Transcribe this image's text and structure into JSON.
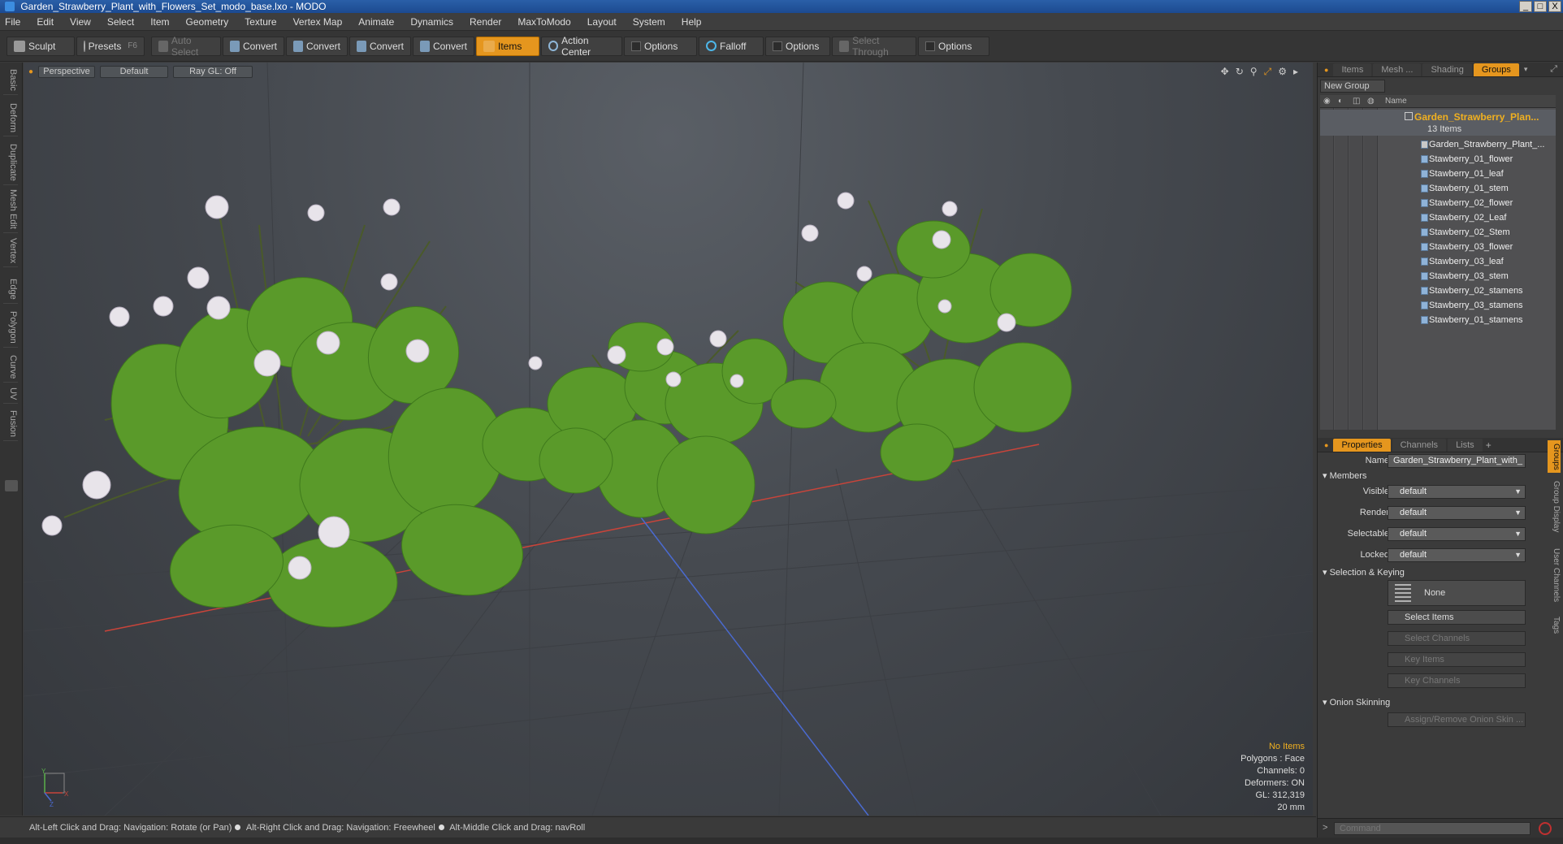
{
  "window": {
    "title": "Garden_Strawberry_Plant_with_Flowers_Set_modo_base.lxo - MODO",
    "buttons": [
      "_",
      "□",
      "X"
    ]
  },
  "menu": [
    "File",
    "Edit",
    "View",
    "Select",
    "Item",
    "Geometry",
    "Texture",
    "Vertex Map",
    "Animate",
    "Dynamics",
    "Render",
    "MaxToModo",
    "Layout",
    "System",
    "Help"
  ],
  "toolbar": {
    "sculpt": "Sculpt",
    "presets": "Presets",
    "presets_key": "F6",
    "auto_select": "Auto Select",
    "convert1": "Convert",
    "convert2": "Convert",
    "convert3": "Convert",
    "convert4": "Convert",
    "items": "Items",
    "action_center": "Action Center",
    "options1": "Options",
    "falloff": "Falloff",
    "options2": "Options",
    "select_through": "Select Through",
    "options3": "Options"
  },
  "left_tabs": [
    "Basic",
    "Deform",
    "Duplicate",
    "Mesh Edit",
    "Vertex",
    "Edge",
    "Polygon",
    "Curve",
    "UV",
    "Fusion"
  ],
  "viewport": {
    "view": "Perspective",
    "shading": "Default",
    "raygl": "Ray GL: Off",
    "info": {
      "selection": "No Items",
      "polygons": "Polygons : Face",
      "channels": "Channels: 0",
      "deformers": "Deformers: ON",
      "gl": "GL: 312,319",
      "scale": "20 mm"
    },
    "axis": {
      "x": "X",
      "y": "Y",
      "z": "Z"
    }
  },
  "status": {
    "hint1": "Alt-Left Click and Drag: Navigation: Rotate (or Pan)",
    "hint2": "Alt-Right Click and Drag: Navigation: Freewheel",
    "hint3": "Alt-Middle Click and Drag: navRoll"
  },
  "scene_panel": {
    "tabs": [
      "Items",
      "Mesh ...",
      "Shading",
      "Groups"
    ],
    "active_tab": "Groups",
    "new_group": "New Group",
    "name_header": "Name",
    "group_name": "Garden_Strawberry_Plan...",
    "group_count": "13 Items",
    "items": [
      "Garden_Strawberry_Plant_...",
      "Stawberry_01_flower",
      "Stawberry_01_leaf",
      "Stawberry_01_stem",
      "Stawberry_02_flower",
      "Stawberry_02_Leaf",
      "Stawberry_02_Stem",
      "Stawberry_03_flower",
      "Stawberry_03_leaf",
      "Stawberry_03_stem",
      "Stawberry_02_stamens",
      "Stawberry_03_stamens",
      "Stawberry_01_stamens"
    ]
  },
  "properties_panel": {
    "tabs": [
      "Properties",
      "Channels",
      "Lists",
      "+"
    ],
    "name_label": "Name",
    "name_value": "Garden_Strawberry_Plant_with_",
    "members": "Members",
    "visible_label": "Visible",
    "visible_value": "default",
    "render_label": "Render",
    "render_value": "default",
    "selectable_label": "Selectable",
    "selectable_value": "default",
    "locked_label": "Locked",
    "locked_value": "default",
    "selection_keying": "Selection & Keying",
    "none": "None",
    "select_items": "Select Items",
    "select_channels": "Select Channels",
    "key_items": "Key Items",
    "key_channels": "Key Channels",
    "onion_skinning": "Onion Skinning",
    "assign_onion": "Assign/Remove Onion Skin ...",
    "side_tabs": [
      "Groups",
      "Group Display",
      "User Channels",
      "Tags"
    ]
  },
  "command": {
    "placeholder": "Command",
    "prompt": ">"
  },
  "colors": {
    "accent": "#e5961e",
    "leaf": "#5a9a2a",
    "flower": "#e8e4ea",
    "grid_x": "#c8443a",
    "grid_z": "#4a6ad0"
  }
}
